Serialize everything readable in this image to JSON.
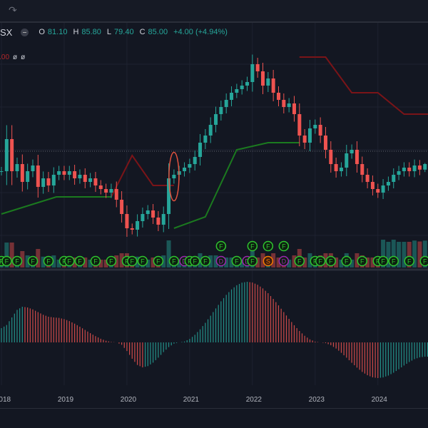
{
  "toolbar": {
    "redo_icon": "redo-arrow-icon"
  },
  "legend": {
    "symbol": "SX",
    "open_label": "O",
    "open": "81.10",
    "high_label": "H",
    "high": "85.80",
    "low_label": "L",
    "low": "79.40",
    "close_label": "C",
    "close": "85.00",
    "change": "+4.00 (+4.94%)"
  },
  "indicator_legend": {
    "value_hidden": "85.00",
    "values": [
      "ø",
      "ø"
    ]
  },
  "colors": {
    "up": "#26a69a",
    "down": "#ef5350",
    "stop_up": "#1b7a1f",
    "stop_down": "#7a1418",
    "event_f": "#2fc42f",
    "event_d": "#9c27b0",
    "event_s": "#f57c00",
    "background": "#131722"
  },
  "chart_data": {
    "type": "candlestick",
    "interval": "monthly",
    "start": "2018-01",
    "x_tick_labels": [
      "2018",
      "2019",
      "2020",
      "2021",
      "2022",
      "2023",
      "2024"
    ],
    "closes": [
      80,
      102.5,
      80,
      85,
      72.5,
      80,
      84,
      69,
      75,
      70,
      77.5,
      80,
      77.5,
      80,
      75,
      77.5,
      72.5,
      75,
      70,
      67.5,
      65,
      67.5,
      60,
      50,
      40,
      39,
      45,
      50,
      52.5,
      47.5,
      42.5,
      50,
      75,
      77.5,
      80,
      82.5,
      85,
      90,
      100,
      105,
      112.5,
      120,
      125,
      130,
      135,
      137.5,
      140,
      142.5,
      155,
      150,
      140,
      145,
      135,
      130,
      125,
      127.5,
      120,
      105,
      100,
      110,
      112.5,
      105,
      95,
      85,
      80,
      82.5,
      92.5,
      95,
      85,
      77.5,
      72.5,
      67.5,
      65,
      70,
      72.5,
      77.5,
      80,
      82.5,
      80,
      84,
      81.1,
      85
    ],
    "last_bar": {
      "open": 81.1,
      "high": 85.8,
      "low": 79.4,
      "close": 85.0
    },
    "stop_line": [
      {
        "from": 0,
        "to": 21,
        "values": [
          50,
          62,
          62
        ],
        "trend": "up"
      },
      {
        "from": 21,
        "to": 33,
        "values": [
          62,
          91,
          70,
          70
        ],
        "trend": "down"
      },
      {
        "from": 33,
        "to": 57,
        "values": [
          40,
          48,
          95,
          100,
          100
        ],
        "trend": "up"
      },
      {
        "from": 57,
        "to": 82,
        "values": [
          160,
          160,
          135,
          135,
          120,
          120
        ],
        "trend": "down"
      }
    ],
    "highlighted_bar": "2020-10",
    "events": [
      {
        "m": 0,
        "t": "F"
      },
      {
        "m": 1,
        "t": "F"
      },
      {
        "m": 3,
        "t": "F"
      },
      {
        "m": 6,
        "t": "F"
      },
      {
        "m": 9,
        "t": "F"
      },
      {
        "m": 12,
        "t": "F"
      },
      {
        "m": 13,
        "t": "F"
      },
      {
        "m": 15,
        "t": "F"
      },
      {
        "m": 18,
        "t": "F"
      },
      {
        "m": 21,
        "t": "F"
      },
      {
        "m": 24,
        "t": "F"
      },
      {
        "m": 25,
        "t": "F"
      },
      {
        "m": 27,
        "t": "F"
      },
      {
        "m": 30,
        "t": "F"
      },
      {
        "m": 33,
        "t": "F"
      },
      {
        "m": 35,
        "t": "D"
      },
      {
        "m": 36,
        "t": "F"
      },
      {
        "m": 37,
        "t": "F"
      },
      {
        "m": 39,
        "t": "F"
      },
      {
        "m": 42,
        "t": "D"
      },
      {
        "m": 45,
        "t": "F"
      },
      {
        "m": 47,
        "t": "D"
      },
      {
        "m": 48,
        "t": "F"
      },
      {
        "m": 51,
        "t": "S"
      },
      {
        "m": 54,
        "t": "D"
      },
      {
        "m": 57,
        "t": "F"
      },
      {
        "m": 60,
        "t": "F"
      },
      {
        "m": 61,
        "t": "F"
      },
      {
        "m": 63,
        "t": "F"
      },
      {
        "m": 66,
        "t": "F"
      },
      {
        "m": 69,
        "t": "F"
      },
      {
        "m": 72,
        "t": "F"
      },
      {
        "m": 73,
        "t": "F"
      },
      {
        "m": 75,
        "t": "F"
      },
      {
        "m": 78,
        "t": "F"
      },
      {
        "m": 81,
        "t": "F"
      },
      {
        "m": 42,
        "t": "F",
        "row": 2
      },
      {
        "m": 48,
        "t": "F",
        "row": 2
      },
      {
        "m": 51,
        "t": "F",
        "row": 2
      },
      {
        "m": 54,
        "t": "F",
        "row": 2
      }
    ],
    "macd_histogram_anchors": [
      [
        0,
        20
      ],
      [
        4,
        50
      ],
      [
        10,
        35
      ],
      [
        22,
        0
      ],
      [
        27,
        -35
      ],
      [
        34,
        0
      ],
      [
        47,
        85
      ],
      [
        61,
        0
      ],
      [
        72,
        -50
      ],
      [
        81,
        -20
      ]
    ]
  }
}
